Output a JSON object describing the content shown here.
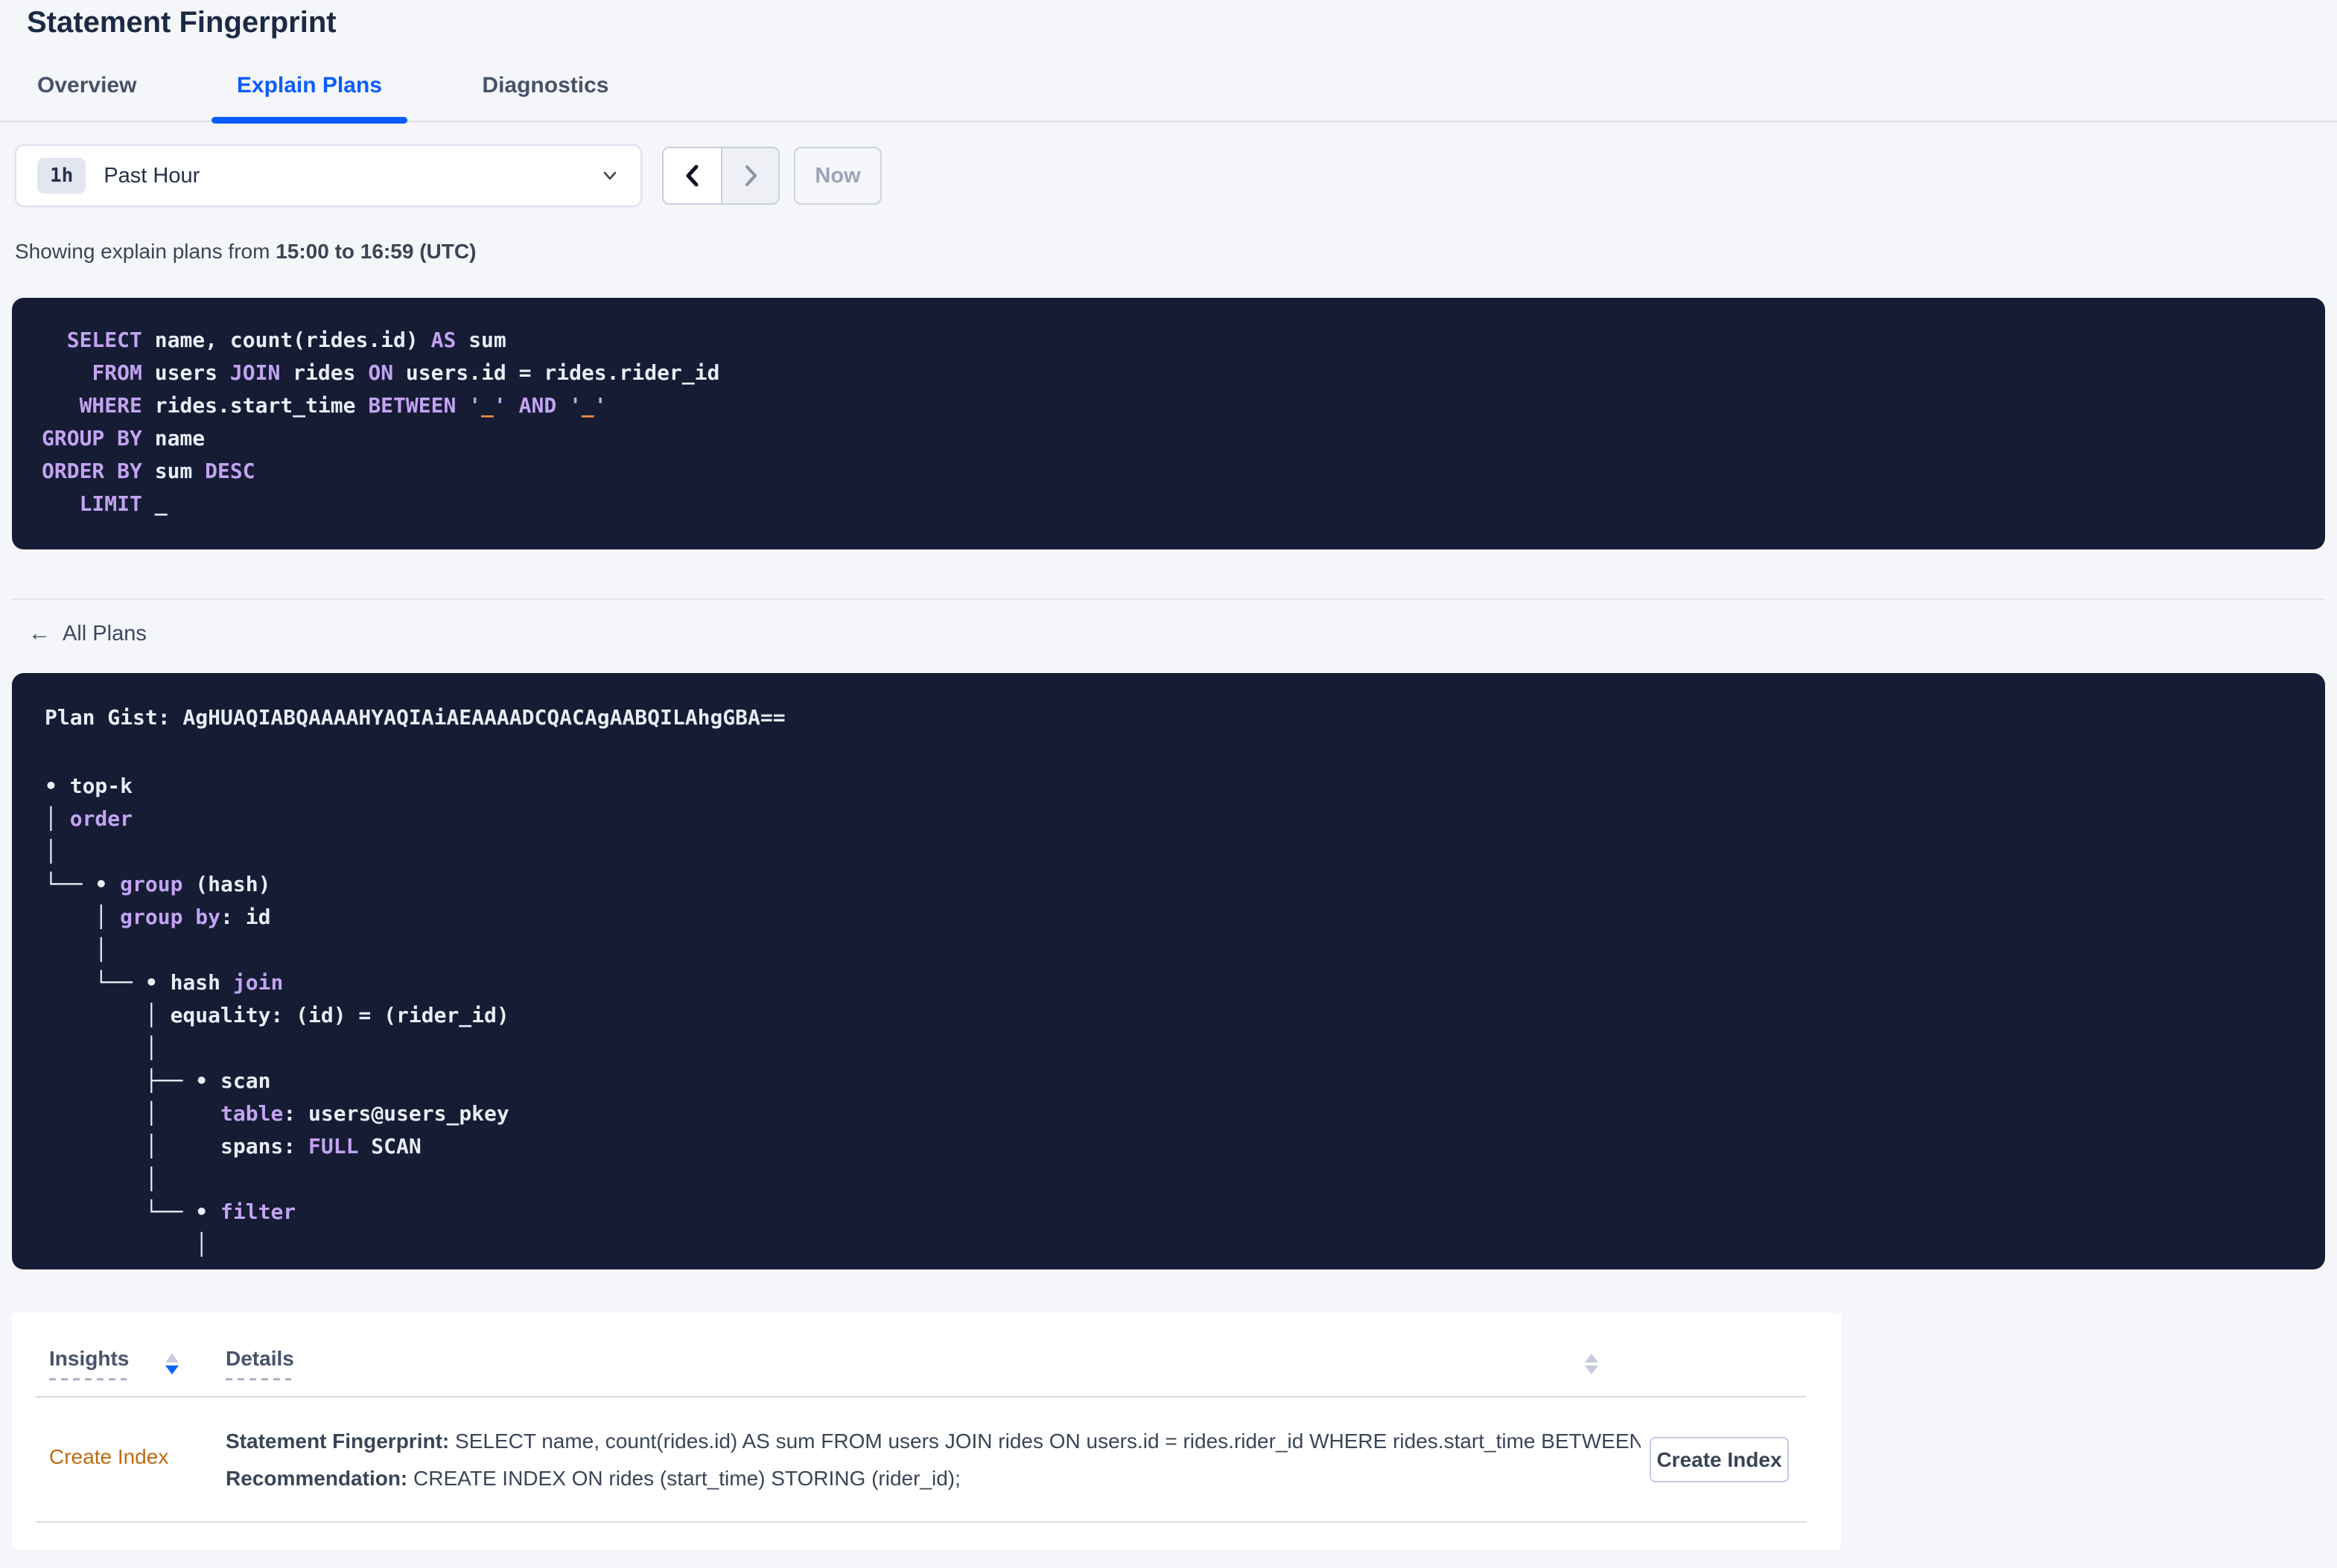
{
  "header": {
    "title": "Statement Fingerprint"
  },
  "tabs": [
    {
      "label": "Overview",
      "active": false
    },
    {
      "label": "Explain Plans",
      "active": true
    },
    {
      "label": "Diagnostics",
      "active": false
    }
  ],
  "time_picker": {
    "badge": "1h",
    "selected": "Past Hour",
    "now_label": "Now"
  },
  "summary": {
    "prefix": "Showing explain plans from ",
    "range": "15:00 to 16:59 (UTC)"
  },
  "sql": {
    "lines": [
      [
        {
          "t": "  "
        },
        {
          "t": "SELECT",
          "c": "k"
        },
        {
          "t": " name, count(rides.id) "
        },
        {
          "t": "AS",
          "c": "k"
        },
        {
          "t": " sum"
        }
      ],
      [
        {
          "t": "    "
        },
        {
          "t": "FROM",
          "c": "k"
        },
        {
          "t": " users "
        },
        {
          "t": "JOIN",
          "c": "k"
        },
        {
          "t": " rides "
        },
        {
          "t": "ON",
          "c": "k"
        },
        {
          "t": " users.id = rides.rider_id"
        }
      ],
      [
        {
          "t": "   "
        },
        {
          "t": "WHERE",
          "c": "k"
        },
        {
          "t": " rides.start_time "
        },
        {
          "t": "BETWEEN",
          "c": "k"
        },
        {
          "t": " "
        },
        {
          "t": "'",
          "c": "k"
        },
        {
          "t": "_",
          "c": "o"
        },
        {
          "t": "'",
          "c": "k"
        },
        {
          "t": " "
        },
        {
          "t": "AND",
          "c": "k"
        },
        {
          "t": " "
        },
        {
          "t": "'",
          "c": "k"
        },
        {
          "t": "_",
          "c": "o"
        },
        {
          "t": "'",
          "c": "k"
        }
      ],
      [
        {
          "t": "GROUP BY",
          "c": "k"
        },
        {
          "t": " name"
        }
      ],
      [
        {
          "t": "ORDER BY",
          "c": "k"
        },
        {
          "t": " sum "
        },
        {
          "t": "DESC",
          "c": "k"
        }
      ],
      [
        {
          "t": "   "
        },
        {
          "t": "LIMIT",
          "c": "k"
        },
        {
          "t": " _"
        }
      ]
    ]
  },
  "back_link": {
    "arrow": "←",
    "label": "All Plans"
  },
  "plan": {
    "gist": "Plan Gist: AgHUAQIABQAAAAHYAQIAiAEAAAADCQACAgAABQILAhgGBA==",
    "tree_lines": [
      [
        {
          "t": "• top-k"
        }
      ],
      [
        {
          "t": "│ "
        },
        {
          "t": "order",
          "c": "k"
        }
      ],
      [
        {
          "t": "│"
        }
      ],
      [
        {
          "t": "└── • "
        },
        {
          "t": "group",
          "c": "k"
        },
        {
          "t": " (hash)"
        }
      ],
      [
        {
          "t": "    │ "
        },
        {
          "t": "group by",
          "c": "k"
        },
        {
          "t": ": id"
        }
      ],
      [
        {
          "t": "    │"
        }
      ],
      [
        {
          "t": "    └── • hash "
        },
        {
          "t": "join",
          "c": "k"
        }
      ],
      [
        {
          "t": "        │ equality: (id) = (rider_id)"
        }
      ],
      [
        {
          "t": "        │"
        }
      ],
      [
        {
          "t": "        ├── • scan"
        }
      ],
      [
        {
          "t": "        │     "
        },
        {
          "t": "table",
          "c": "k"
        },
        {
          "t": ": users@users_pkey"
        }
      ],
      [
        {
          "t": "        │     spans: "
        },
        {
          "t": "FULL",
          "c": "k"
        },
        {
          "t": " SCAN"
        }
      ],
      [
        {
          "t": "        │"
        }
      ],
      [
        {
          "t": "        └── • "
        },
        {
          "t": "filter",
          "c": "k"
        }
      ],
      [
        {
          "t": "            │"
        }
      ]
    ]
  },
  "insights_table": {
    "headers": [
      {
        "label": "Insights"
      },
      {
        "label": "Details"
      }
    ],
    "row": {
      "insight_link": "Create Index",
      "fingerprint_label": "Statement Fingerprint:",
      "fingerprint_text": " SELECT name, count(rides.id) AS sum FROM users JOIN rides ON users.id = rides.rider_id WHERE rides.start_time BETWEEN '_…",
      "recommendation_label": "Recommendation:",
      "recommendation_text": " CREATE INDEX ON rides (start_time) STORING (rider_id);",
      "action_button": "Create Index"
    }
  },
  "colors": {
    "accent_blue": "#0b5cff",
    "code_background": "#151c34",
    "code_keyword_purple": "#c3a3f1",
    "code_literal_orange": "#fc9044",
    "insight_link_orange": "#c06a12",
    "page_background": "#f5f6fa"
  }
}
